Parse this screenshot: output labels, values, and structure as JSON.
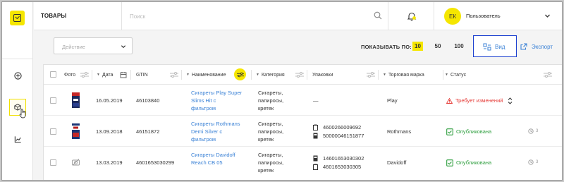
{
  "topbar": {
    "title": "ТОВАРЫ",
    "search_placeholder": "Поиск",
    "user": {
      "initials": "ЕК",
      "name": "Пользователь"
    }
  },
  "toolbar": {
    "action_placeholder": "Действие",
    "show_by_label": "ПОКАЗЫВАТЬ ПО:",
    "page_sizes": [
      "10",
      "50",
      "100"
    ],
    "active_page_size": "10",
    "view_label": "Вид",
    "export_label": "Экспорт"
  },
  "table": {
    "headers": {
      "photo": "Фото",
      "date": "Дата",
      "gtin": "GTIN",
      "name": "Наименование",
      "category": "Категория",
      "packaging": "Упаковки",
      "brand": "Торговая марка",
      "status": "Статус"
    },
    "rows": [
      {
        "date": "16.05.2019",
        "gtin": "46103840",
        "name": [
          "Сигареты Play Super",
          "Slims Hit с",
          "фильтром"
        ],
        "category": [
          "Сигареты,",
          "папиросы,",
          "кретек"
        ],
        "packaging": [
          "—"
        ],
        "brand": "Play",
        "status": "Требует изменений",
        "history": ""
      },
      {
        "date": "13.09.2018",
        "gtin": "46151872",
        "name": [
          "Сигареты Rothmans",
          "Demi Silver с",
          "фильтром"
        ],
        "category": [
          "Сигареты,",
          "папиросы,",
          "кретек"
        ],
        "packaging": [
          "4600266009692",
          "50000046151877"
        ],
        "brand": "Rothmans",
        "status": "Опубликована",
        "history": "3"
      },
      {
        "date": "13.03.2019",
        "gtin": "4601653030299",
        "name": [
          "Сигареты Davidoff",
          "Reach CB 05"
        ],
        "category": [
          "Сигареты,",
          "папиросы,",
          "кретек"
        ],
        "packaging": [
          "14601653030302",
          "4601653030305"
        ],
        "brand": "Davidoff",
        "status": "Опубликована",
        "history": "3"
      }
    ]
  },
  "colors": {
    "accent_yellow": "#f5e600",
    "link_blue": "#3b82d6",
    "warning_red": "#e53935",
    "published_green": "#2e9e3e",
    "highlight_border": "#1a3ecf"
  }
}
